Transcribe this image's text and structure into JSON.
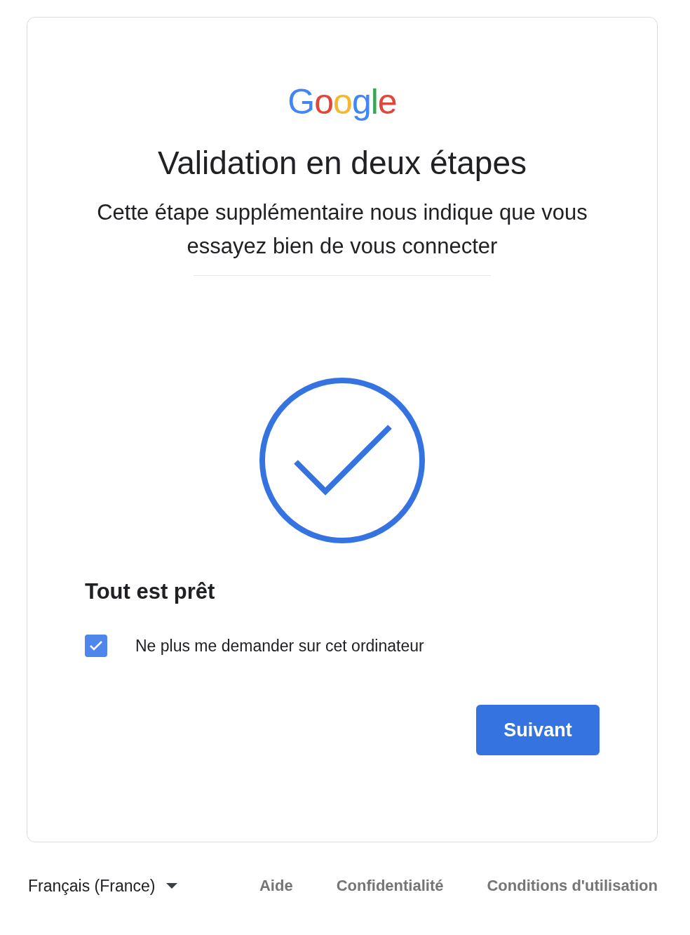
{
  "logo": "Google",
  "title": "Validation en deux étapes",
  "subtitle": "Cette étape supplémentaire nous indique que vous essayez bien de vous connecter",
  "heading": "Tout est prêt",
  "remember_device": {
    "label": "Ne plus me demander sur cet ordinateur",
    "checked": true
  },
  "next_button": "Suivant",
  "footer": {
    "language": "Français (France)",
    "links": [
      "Aide",
      "Confidentialité",
      "Conditions d'utilisation"
    ]
  }
}
